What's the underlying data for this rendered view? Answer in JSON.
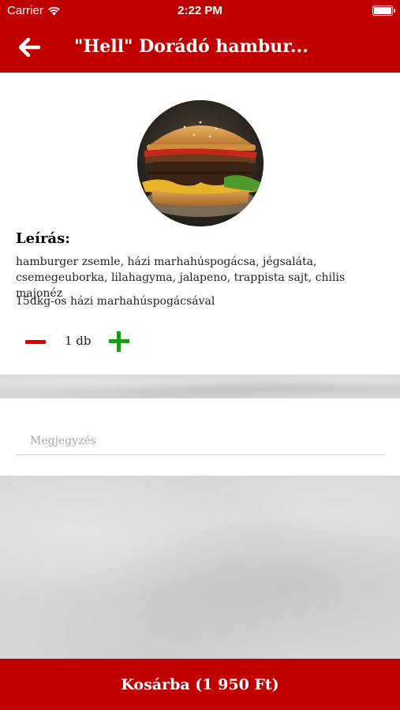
{
  "status_bar": {
    "carrier": "Carrier",
    "time": "2:22 PM",
    "icons": [
      "wifi-icon",
      "battery-icon"
    ]
  },
  "header": {
    "back_icon": "arrow-left-icon",
    "title": "\"Hell\" Dorádó hambur..."
  },
  "product": {
    "image": "burger-photo",
    "description_heading": "Leírás:",
    "description": "hamburger zsemle, házi marhahúspogácsa, jégsaláta, csemegeuborka, lilahagyma, jalapeno, trappista sajt, chilis majonéz",
    "extra_info": "15dkg-os házi marhahúspogácsával",
    "quantity": {
      "value_label": "1 db",
      "minus_icon": "minus-icon",
      "plus_icon": "plus-icon"
    }
  },
  "note": {
    "placeholder": "Megjegyzés",
    "value": ""
  },
  "cart_button": {
    "label": "Kosárba (1 950 Ft)"
  },
  "colors": {
    "brand_red": "#c00000",
    "minus_red": "#e00000",
    "plus_green": "#1a9a1a",
    "background_gray": "#d6d6d6"
  }
}
